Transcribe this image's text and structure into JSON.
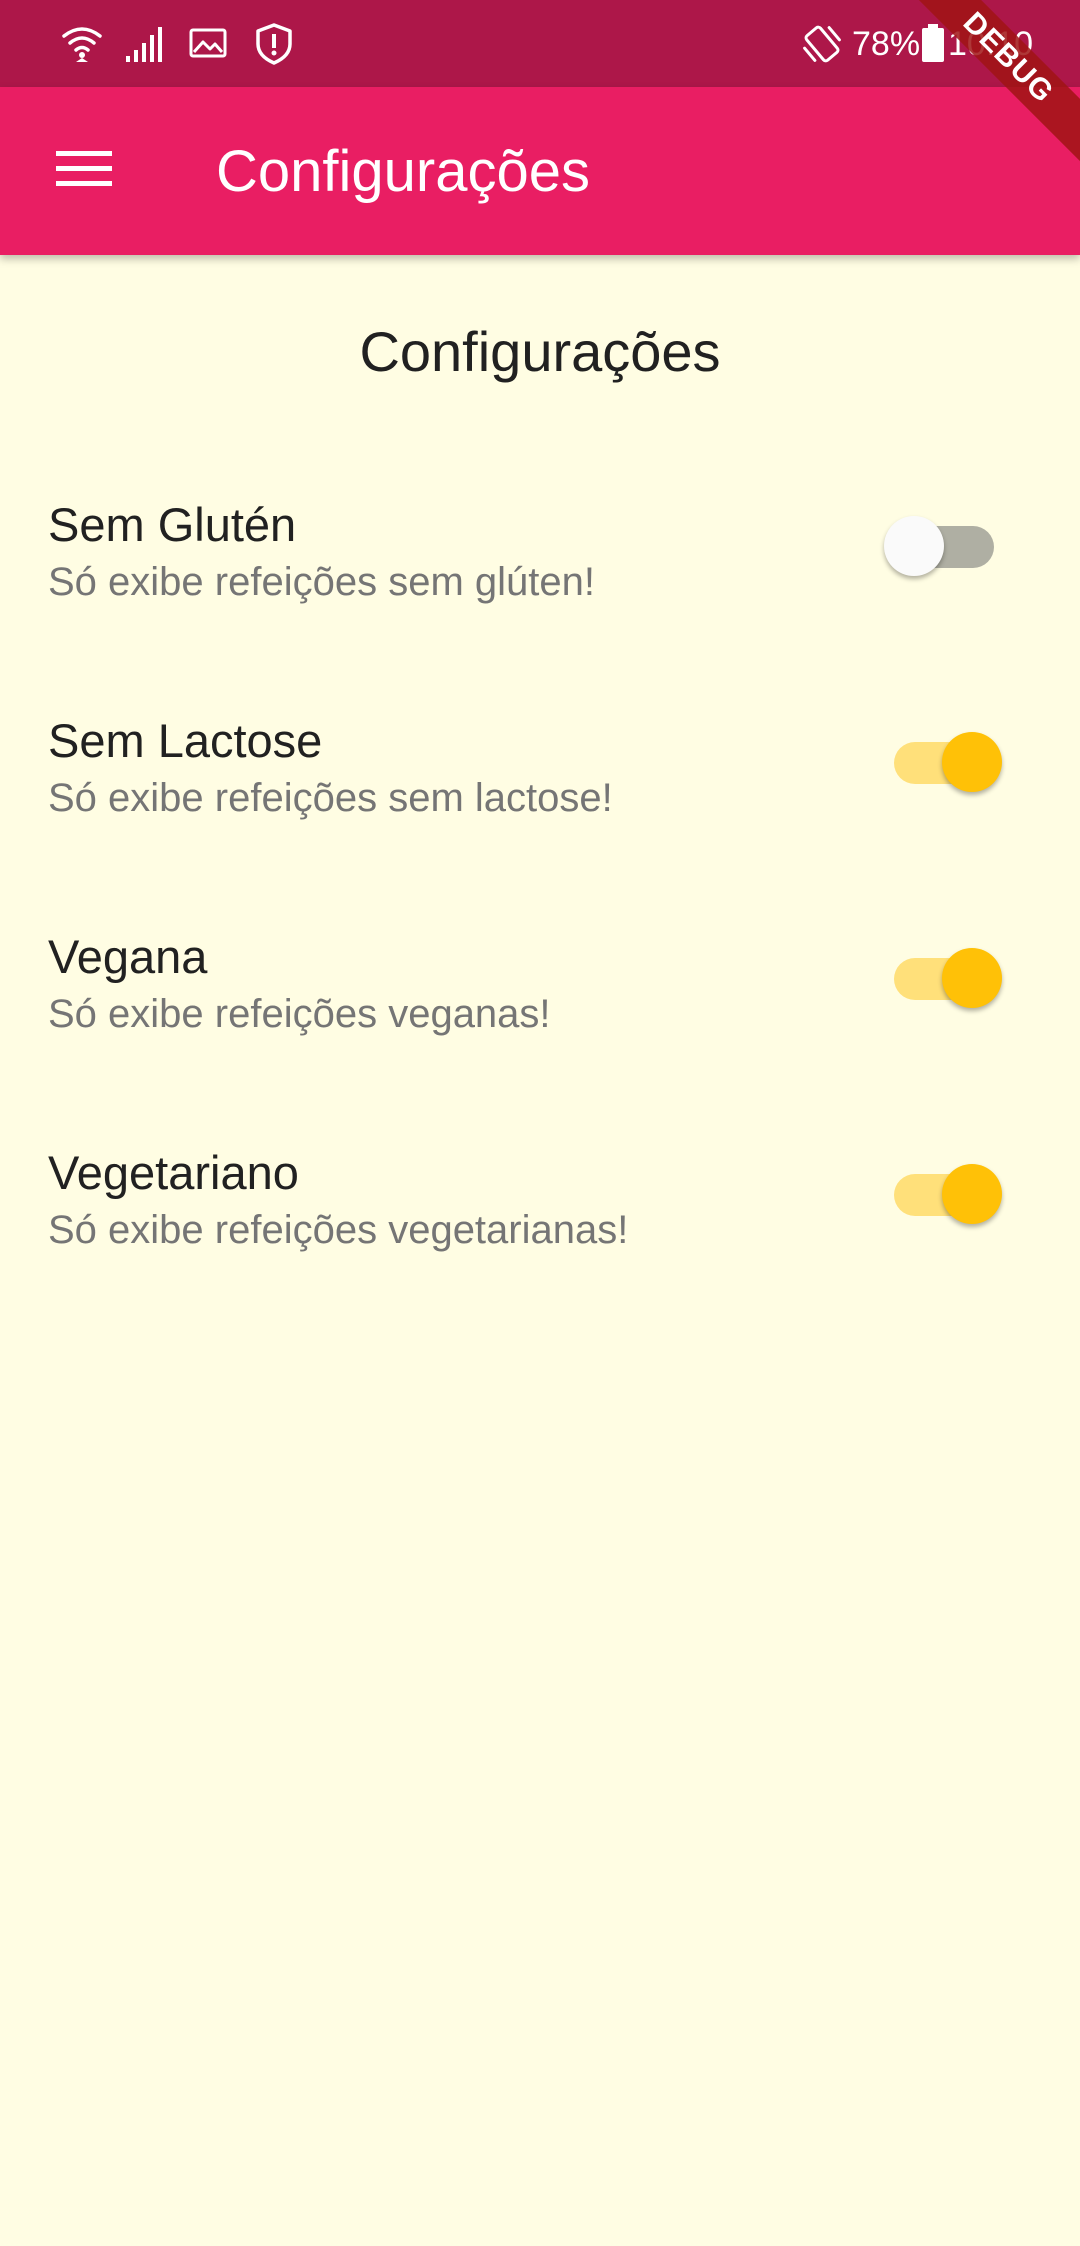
{
  "status_bar": {
    "battery_percent": "78%",
    "time": "10:10",
    "icons": [
      "wifi-icon",
      "signal-icon",
      "image-icon",
      "shield-icon",
      "vibrate-icon",
      "battery-icon"
    ]
  },
  "app_bar": {
    "menu_icon": "menu-icon",
    "title": "Configurações"
  },
  "debug_banner": "DEBUG",
  "page": {
    "heading": "Configurações"
  },
  "settings": [
    {
      "title": "Sem Glutén",
      "subtitle": "Só exibe refeições sem glúten!",
      "enabled": false
    },
    {
      "title": "Sem Lactose",
      "subtitle": "Só exibe refeições sem lactose!",
      "enabled": true
    },
    {
      "title": "Vegana",
      "subtitle": "Só exibe refeições veganas!",
      "enabled": true
    },
    {
      "title": "Vegetariano",
      "subtitle": "Só exibe refeições vegetarianas!",
      "enabled": true
    }
  ],
  "colors": {
    "status_bar": "#AD1749",
    "app_bar": "#E91E63",
    "background": "#FFFDE3",
    "switch_on_thumb": "#FFC107",
    "switch_on_track": "#FFE07A",
    "switch_off_track": "#AFAFA3"
  }
}
